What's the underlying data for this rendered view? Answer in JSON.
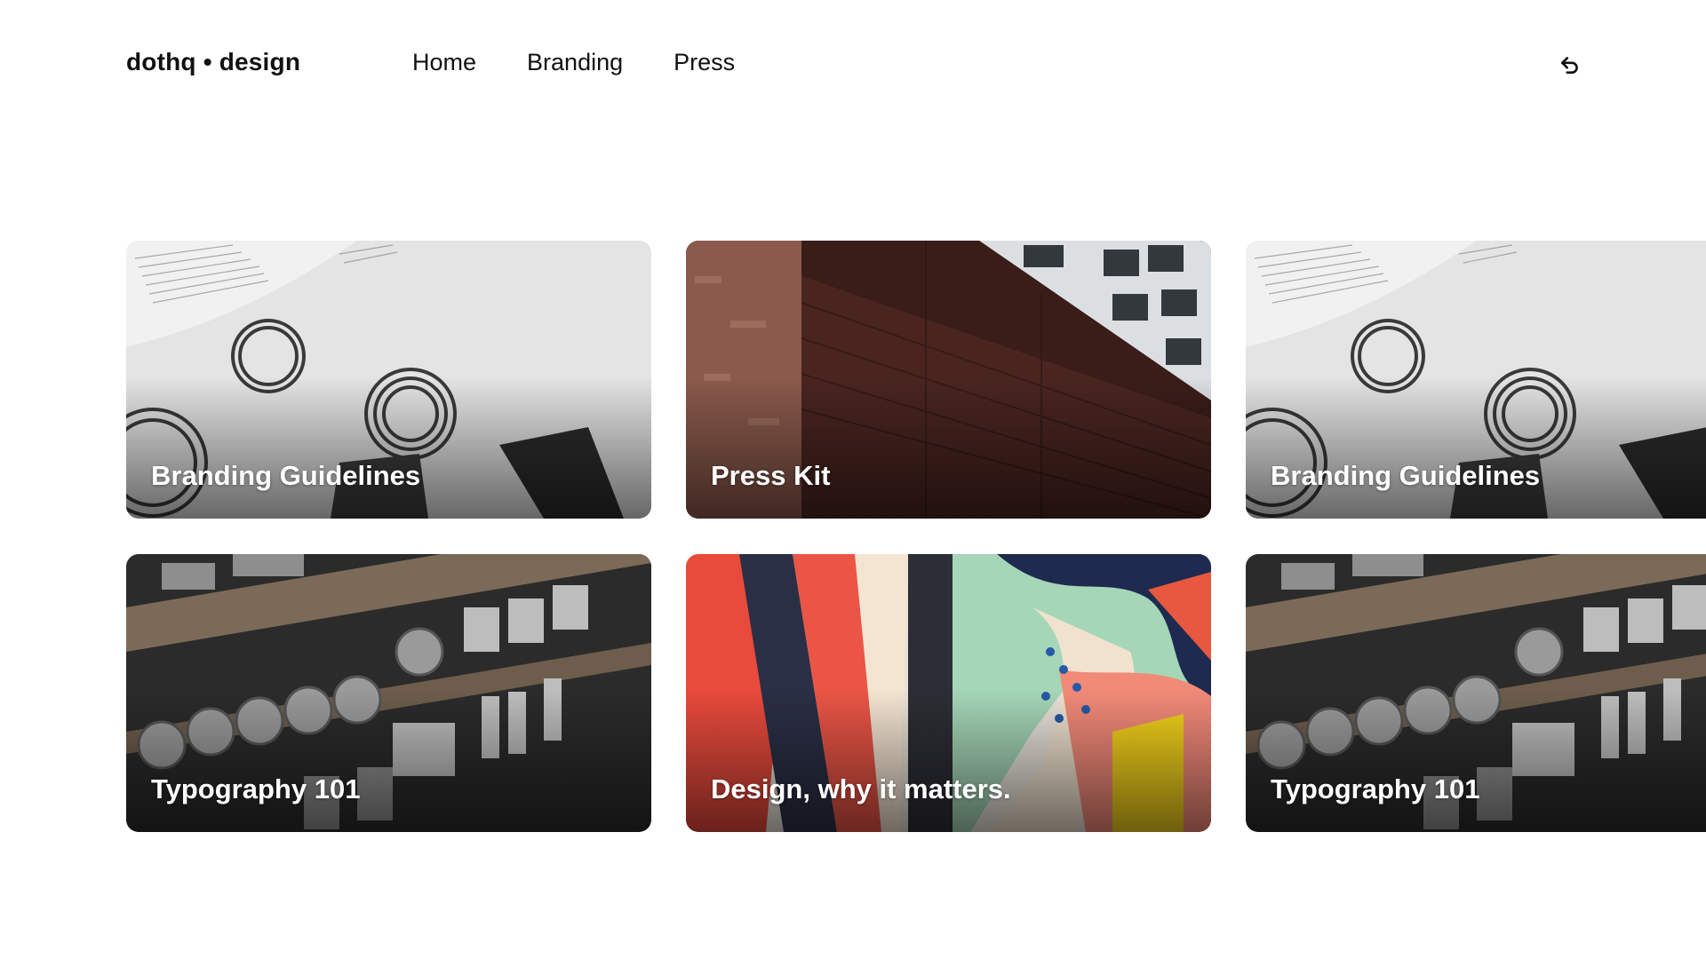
{
  "header": {
    "logo": "dothq • design",
    "nav": [
      {
        "label": "Home"
      },
      {
        "label": "Branding"
      },
      {
        "label": "Press"
      }
    ],
    "back_icon": "undo-arrow-icon"
  },
  "cards": [
    {
      "title": "Branding Guidelines",
      "image": "numbered-paper-photo"
    },
    {
      "title": "Press Kit",
      "image": "brick-building-photo"
    },
    {
      "title": "Branding Guidelines",
      "image": "numbered-paper-photo"
    },
    {
      "title": "Typography 101",
      "image": "metal-type-blocks-photo"
    },
    {
      "title": "Design, why it matters.",
      "image": "colorful-mural-photo"
    },
    {
      "title": "Typography 101",
      "image": "metal-type-blocks-photo"
    }
  ],
  "colors": {
    "background": "#ffffff",
    "text": "#111111",
    "card_title": "#ffffff"
  }
}
